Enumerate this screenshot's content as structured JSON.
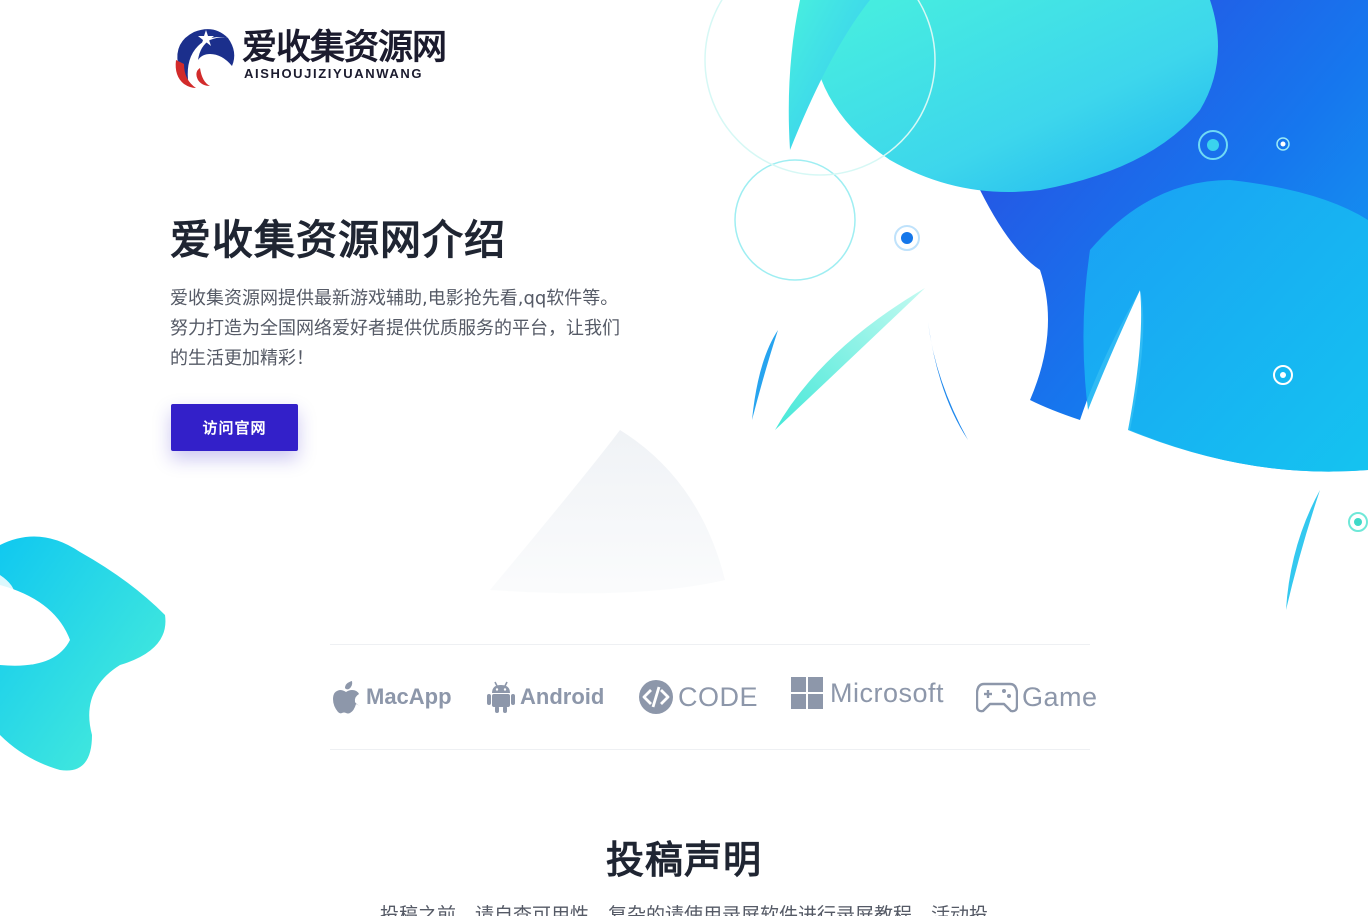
{
  "brand": {
    "name": "爱收集资源网",
    "subtitle": "AISHOUJIZIYUANWANG",
    "logo_icon": "globe-star-logo-icon"
  },
  "hero": {
    "title": "爱收集资源网介绍",
    "description": "爱收集资源网提供最新游戏辅助,电影抢先看,qq软件等。努力打造为全国网络爱好者提供优质服务的平台，让我们的生活更加精彩！",
    "button_label": "访问官网"
  },
  "platforms": [
    {
      "label": "MacApp",
      "icon": "apple-icon"
    },
    {
      "label": "Android",
      "icon": "android-icon"
    },
    {
      "label": "CODE",
      "icon": "code-icon"
    },
    {
      "label": "Microsoft",
      "icon": "windows-icon"
    },
    {
      "label": "Game",
      "icon": "gamepad-icon"
    }
  ],
  "section": {
    "title": "投稿声明",
    "description": "投稿之前，请自查可用性，复杂的请使用录屏软件进行录屏教程，活动投"
  },
  "colors": {
    "accent_button": "#3320c9",
    "title_text": "#1f2532",
    "body_text": "#555a66",
    "platform_icon": "#8d97aa",
    "shape_blue": "#1c5ae0",
    "shape_cyan": "#30d7e8"
  }
}
